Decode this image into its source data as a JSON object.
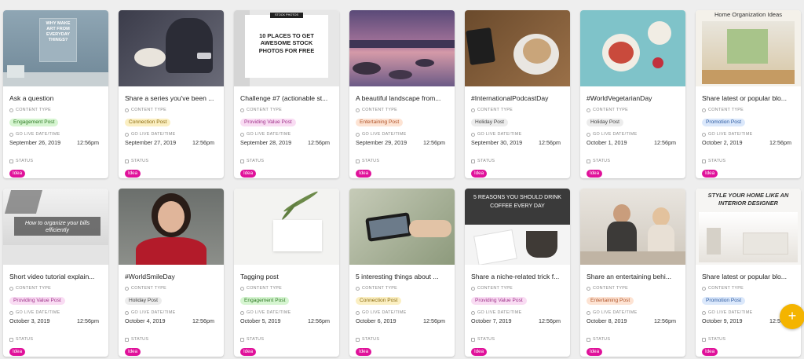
{
  "labels": {
    "content_type": "CONTENT TYPE",
    "go_live": "GO LIVE DATE/TIME",
    "status": "STATUS"
  },
  "cards": [
    {
      "title": "Ask a question",
      "type": "Engagement Post",
      "date": "September 26, 2019",
      "time": "12:56pm",
      "status": "Idea",
      "thumb_text": "WHY MAKE ART FROM EVERYDAY THINGS?"
    },
    {
      "title": "Share a series you've been ...",
      "type": "Connection Post",
      "date": "September 27, 2019",
      "time": "12:56pm",
      "status": "Idea"
    },
    {
      "title": "Challenge #7 (actionable st...",
      "type": "Providing Value Post",
      "date": "September 28, 2019",
      "time": "12:56pm",
      "status": "Idea",
      "thumb_small": "STOCK PHOTOS",
      "thumb_text": "10 PLACES TO GET AWESOME STOCK PHOTOS FOR FREE"
    },
    {
      "title": "A beautiful landscape from...",
      "type": "Entertaining Post",
      "date": "September 29, 2019",
      "time": "12:56pm",
      "status": "Idea"
    },
    {
      "title": "#InternationalPodcastDay",
      "type": "Holiday Post",
      "date": "September 30, 2019",
      "time": "12:56pm",
      "status": "Idea"
    },
    {
      "title": "#WorldVegetarianDay",
      "type": "Holiday Post",
      "date": "October 1, 2019",
      "time": "12:56pm",
      "status": "Idea"
    },
    {
      "title": "Share latest or popular blo...",
      "type": "Promotion Post",
      "date": "October 2, 2019",
      "time": "12:56pm",
      "status": "Idea",
      "thumb_text": "Home Organization Ideas"
    },
    {
      "title": "Short video tutorial explain...",
      "type": "Providing Value Post",
      "date": "October 3, 2019",
      "time": "12:56pm",
      "status": "Idea",
      "thumb_text": "How to organize your bills efficiently"
    },
    {
      "title": "#WorldSmileDay",
      "type": "Holiday Post",
      "date": "October 4, 2019",
      "time": "12:56pm",
      "status": "Idea"
    },
    {
      "title": "Tagging post",
      "type": "Engagement Post",
      "date": "October 5, 2019",
      "time": "12:56pm",
      "status": "Idea"
    },
    {
      "title": "5 interesting things about ...",
      "type": "Connection Post",
      "date": "October 6, 2019",
      "time": "12:56pm",
      "status": "Idea"
    },
    {
      "title": "Share a niche-related trick f...",
      "type": "Providing Value Post",
      "date": "October 7, 2019",
      "time": "12:56pm",
      "status": "Idea",
      "thumb_text": "5 REASONS YOU SHOULD DRINK COFFEE EVERY DAY"
    },
    {
      "title": "Share an entertaining behi...",
      "type": "Entertaining Post",
      "date": "October 8, 2019",
      "time": "12:56pm",
      "status": "Idea"
    },
    {
      "title": "Share latest or popular blo...",
      "type": "Promotion Post",
      "date": "October 9, 2019",
      "time": "12:56pm",
      "status": "Idea",
      "thumb_text": "STYLE YOUR HOME LIKE AN INTERIOR DESIGNER"
    }
  ],
  "tag_colors": {
    "Engagement Post": {
      "bg": "#d6f5d1",
      "fg": "#2f7a25"
    },
    "Connection Post": {
      "bg": "#fbefc2",
      "fg": "#8a6b10"
    },
    "Providing Value Post": {
      "bg": "#f9dcf3",
      "fg": "#a0338a"
    },
    "Entertaining Post": {
      "bg": "#fde3d3",
      "fg": "#b0542a"
    },
    "Holiday Post": {
      "bg": "#ececec",
      "fg": "#444"
    },
    "Promotion Post": {
      "bg": "#dbe8fb",
      "fg": "#2c5aa0"
    }
  },
  "fab": {
    "label": "+",
    "icon": "plus-icon",
    "color": "#f4b400"
  }
}
